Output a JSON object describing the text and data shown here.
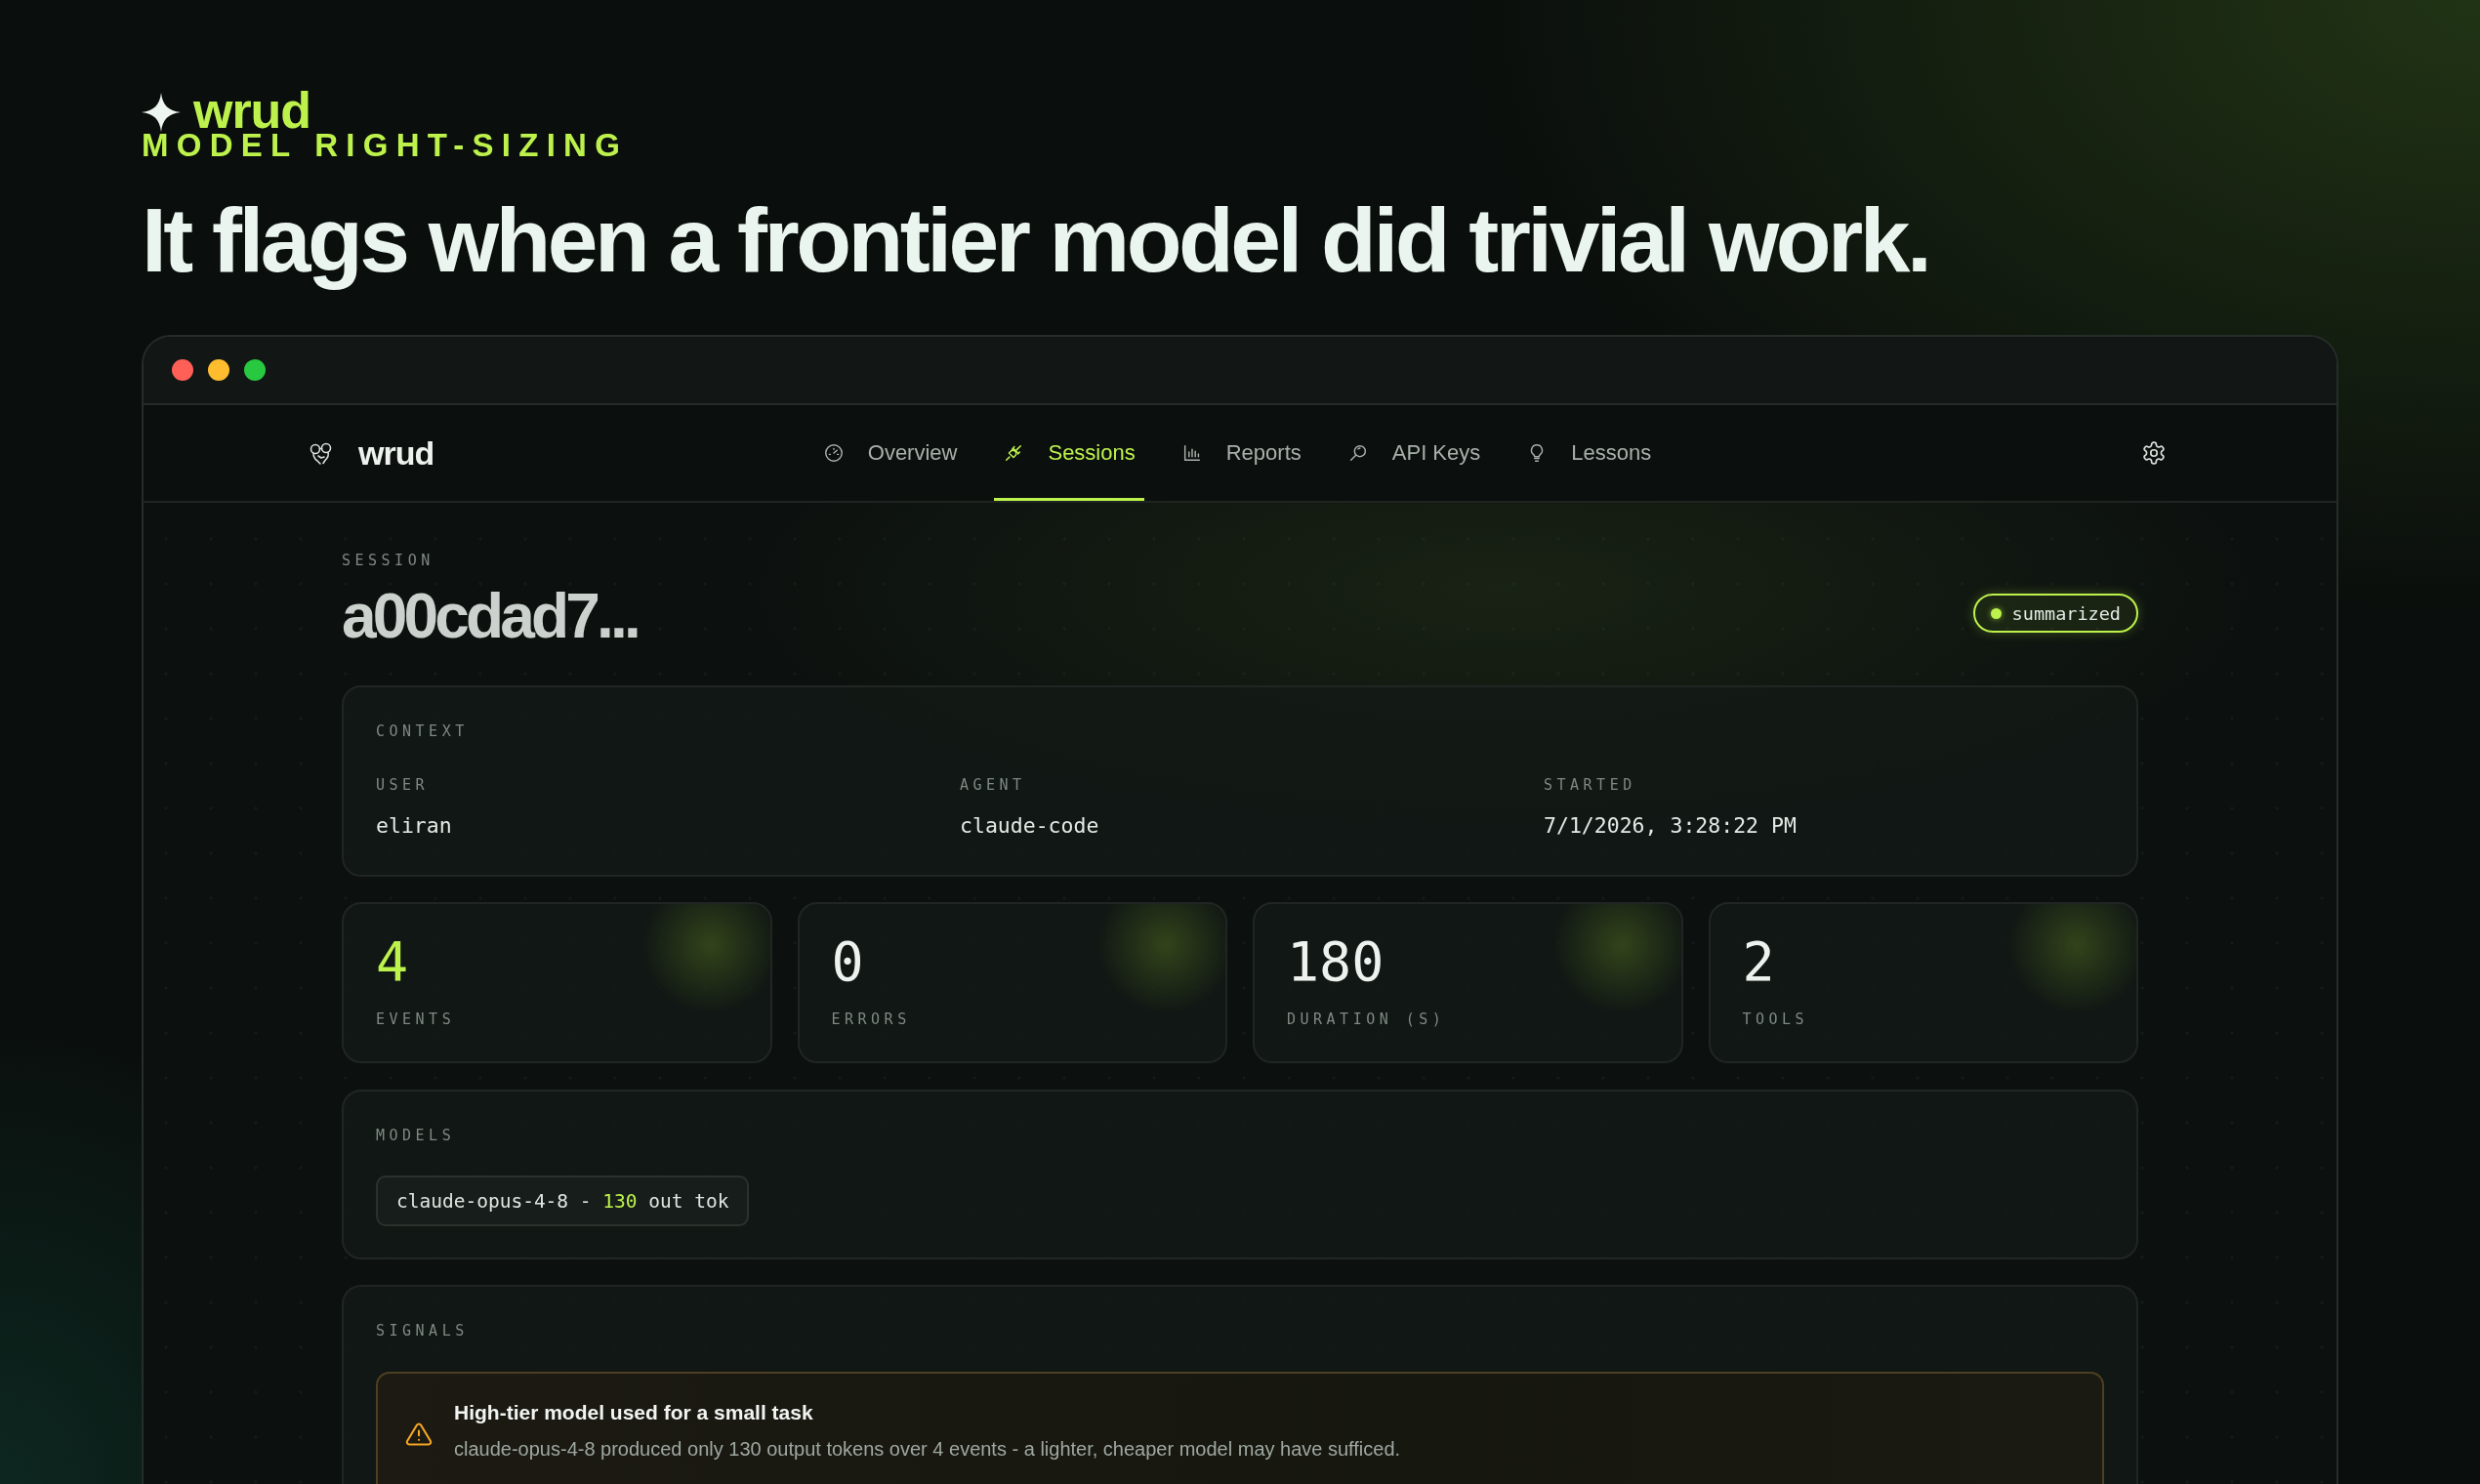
{
  "brand": {
    "name": "wrud",
    "tagline": "MODEL RIGHT-SIZING"
  },
  "headline": "It flags when a frontier model did trivial work.",
  "nav": {
    "brand": "wrud",
    "items": [
      {
        "label": "Overview",
        "selected": false
      },
      {
        "label": "Sessions",
        "selected": true
      },
      {
        "label": "Reports",
        "selected": false
      },
      {
        "label": "API Keys",
        "selected": false
      },
      {
        "label": "Lessons",
        "selected": false
      }
    ]
  },
  "session": {
    "label": "SESSION",
    "title": "a00cdad7...",
    "status": "summarized"
  },
  "context": {
    "title": "CONTEXT",
    "fields": [
      {
        "label": "USER",
        "value": "eliran"
      },
      {
        "label": "AGENT",
        "value": "claude-code"
      },
      {
        "label": "STARTED",
        "value": "7/1/2026, 3:28:22 PM"
      }
    ]
  },
  "stats": [
    {
      "value": "4",
      "label": "EVENTS",
      "highlighted": true
    },
    {
      "value": "0",
      "label": "ERRORS",
      "highlighted": false
    },
    {
      "value": "180",
      "label": "DURATION (S)",
      "highlighted": false
    },
    {
      "value": "2",
      "label": "TOOLS",
      "highlighted": false
    }
  ],
  "models": {
    "title": "MODELS",
    "chips": [
      {
        "model": "claude-opus-4-8",
        "separator": "-",
        "tokens": "130",
        "unit": "out tok"
      }
    ]
  },
  "signals": {
    "title": "SIGNALS",
    "items": [
      {
        "kind": "warning",
        "title": "High-tier model used for a small task",
        "description": "claude-opus-4-8 produced only 130 output tokens over 4 events - a lighter, cheaper model may have sufficed."
      }
    ]
  }
}
